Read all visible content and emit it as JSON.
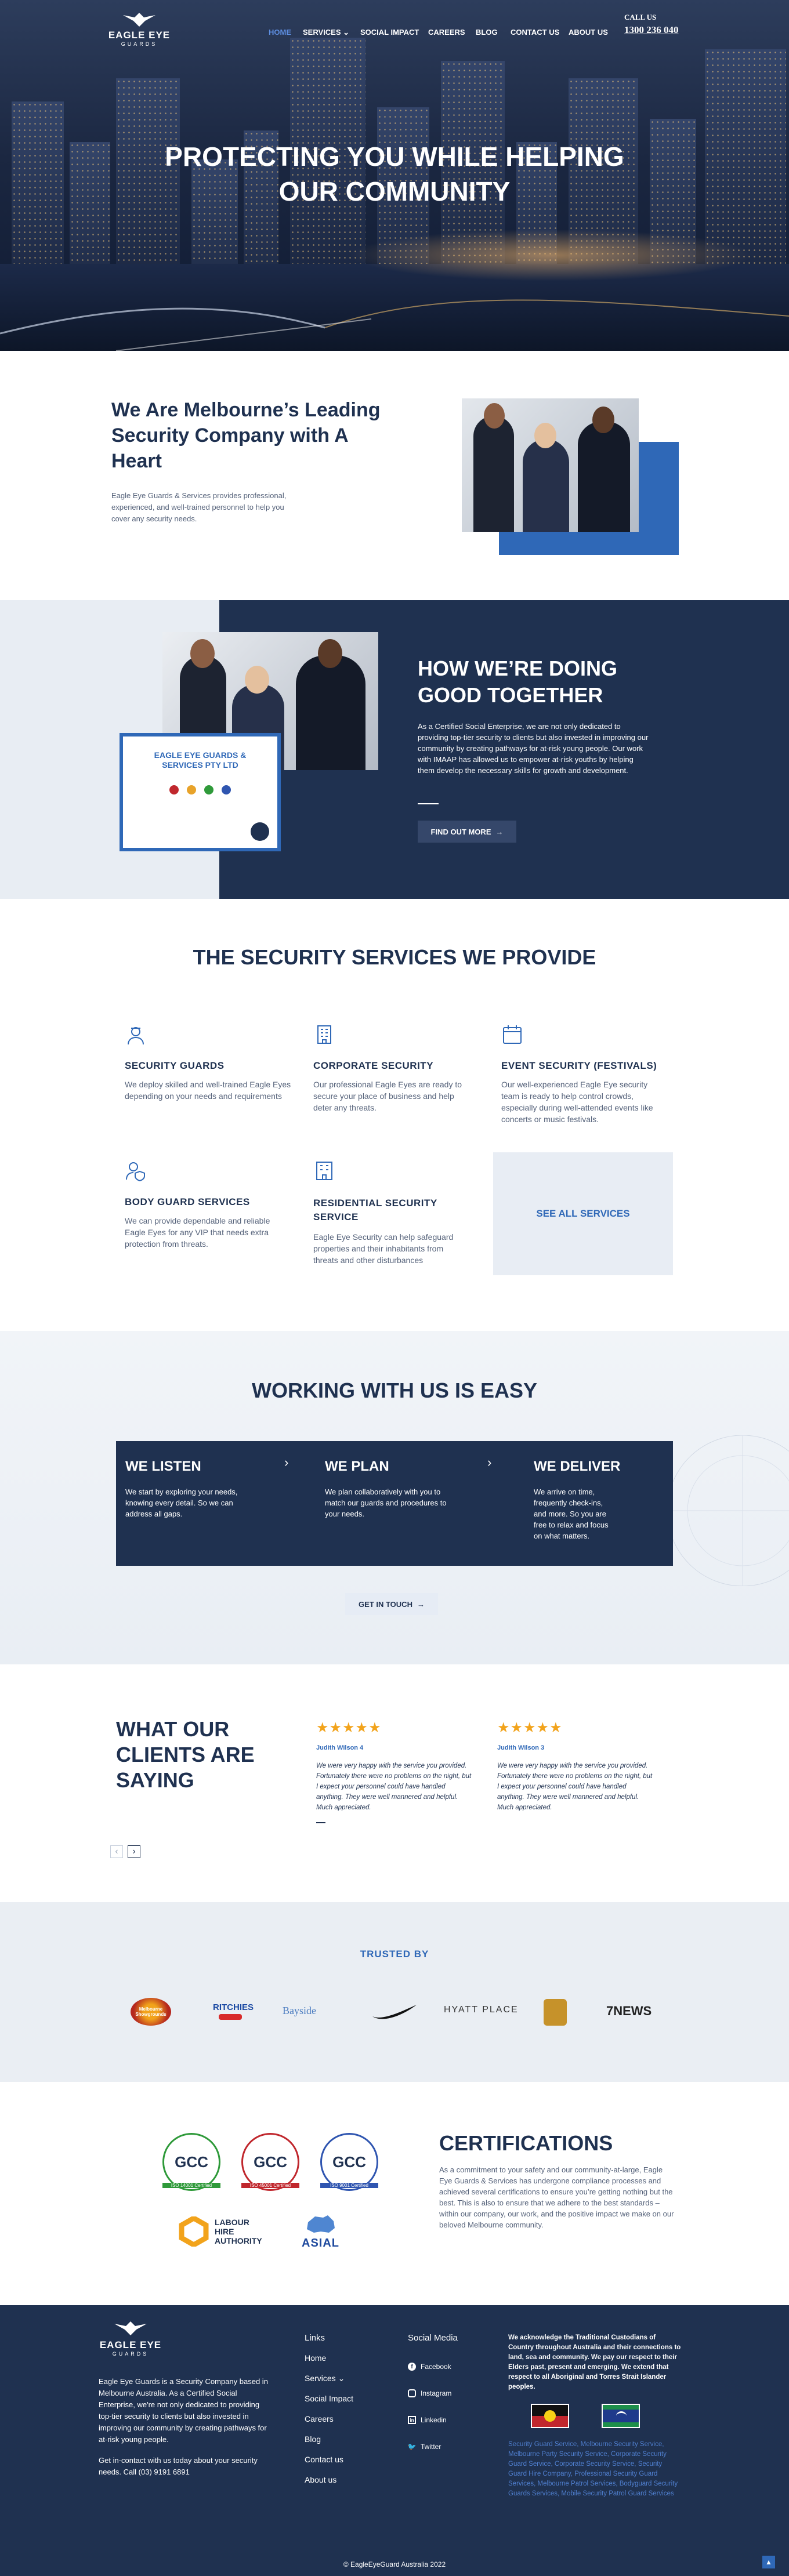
{
  "header": {
    "logo_line1": "EAGLE EYE",
    "logo_line2": "GUARDS",
    "nav": [
      "HOME",
      "SERVICES ⌄",
      "SOCIAL IMPACT",
      "CAREERS",
      "BLOG",
      "CONTACT US",
      "ABOUT US"
    ],
    "call_label": "CALL US",
    "phone": "1300 236 040"
  },
  "hero": {
    "title": "PROTECTING YOU WHILE HELPING OUR COMMUNITY"
  },
  "about": {
    "title": "We Are Melbourne’s Leading Security Company with A Heart",
    "body": "Eagle Eye Guards & Services provides professional, experienced, and well-trained personnel to help you cover any security needs."
  },
  "good": {
    "title": "HOW WE’RE DOING GOOD TOGETHER",
    "body": "As a Certified Social Enterprise, we are not only dedicated to providing top-tier security to clients but also invested in improving our community by creating pathways for at-risk young people. Our work with IMAAP has allowed us to empower at-risk youths by helping them develop the necessary skills for growth and development.",
    "button": "FIND OUT MORE",
    "cert_company": "EAGLE EYE GUARDS & SERVICES PTY LTD"
  },
  "services": {
    "title": "THE SECURITY SERVICES WE PROVIDE",
    "items": [
      {
        "icon": "guard-icon",
        "title": "SECURITY GUARDS",
        "body": "We deploy skilled and well-trained Eagle Eyes depending on your needs and requirements"
      },
      {
        "icon": "building-icon",
        "title": "CORPORATE SECURITY",
        "body": "Our professional Eagle Eyes are ready to secure your place of business and help deter any threats."
      },
      {
        "icon": "calendar-icon",
        "title": "EVENT SECURITY (FESTIVALS)",
        "body": "Our well-experienced Eagle Eye security team is ready to help control crowds, especially during well-attended events like concerts or music festivals."
      },
      {
        "icon": "bodyguard-icon",
        "title": "BODY GUARD SERVICES",
        "body": "We can provide dependable and reliable Eagle Eyes for any VIP that needs extra protection from threats."
      },
      {
        "icon": "residence-icon",
        "title": "RESIDENTIAL SECURITY SERVICE",
        "body": "Eagle Eye Security can help safeguard properties and their inhabitants from threats and other disturbances"
      }
    ],
    "see_all": "SEE ALL SERVICES"
  },
  "easy": {
    "title": "WORKING WITH US IS EASY",
    "steps": [
      {
        "title": "WE LISTEN",
        "body": "We start by exploring your needs, knowing every detail. So we can address all gaps."
      },
      {
        "title": "WE PLAN",
        "body": "We plan collaboratively with you to match our guards and procedures to your needs."
      },
      {
        "title": "WE DELIVER",
        "body": "We arrive on time, frequently check-ins, and more. So you are free to relax and focus on what matters."
      }
    ],
    "button": "GET IN TOUCH"
  },
  "testimonials": {
    "title": "WHAT OUR CLIENTS ARE SAYING",
    "stars": "★★★★★",
    "items": [
      {
        "name": "Judith Wilson 4",
        "body": "We were very happy with the service you provided. Fortunately there were no problems on the night, but I expect your personnel could have handled anything. They were well mannered and helpful. Much appreciated."
      },
      {
        "name": "Judith Wilson 3",
        "body": "We were very happy with the service you provided. Fortunately there were no problems on the night, but I expect your personnel could have handled anything. They were well mannered and helpful. Much appreciated."
      }
    ],
    "prev": "‹",
    "next": "›"
  },
  "trusted": {
    "title": "TRUSTED BY",
    "logos": [
      "Melbourne Showgrounds",
      "RITCHIES",
      "Bayside",
      "Nike",
      "HYATT PLACE",
      "Crest",
      "7NEWS"
    ]
  },
  "certifications": {
    "title": "CERTIFICATIONS",
    "body": "As a commitment to your safety and our community-at-large, Eagle Eye Guards & Services has undergone compliance processes and achieved several certifications to ensure you’re getting nothing but the best. This is also to ensure that we adhere to the best standards – within our company, our work, and the positive impact we make on our beloved Melbourne community.",
    "badges": [
      {
        "mark": "GCC",
        "caption": "ISO 14001 Certified",
        "color": "#2f9a3a"
      },
      {
        "mark": "GCC",
        "caption": "ISO 45001 Certified",
        "color": "#c0272d"
      },
      {
        "mark": "GCC",
        "caption": "ISO 9001 Certified",
        "color": "#2f55b0"
      }
    ],
    "labour": {
      "line1": "LABOUR",
      "line2": "HIRE",
      "line3": "AUTHORITY"
    },
    "asial": "ASIAL"
  },
  "footer": {
    "logo_line1": "EAGLE EYE",
    "logo_line2": "GUARDS",
    "about": "Eagle Eye Guards is a Security Company based in Melbourne Australia. As a Certified Social Enterprise, we're not only dedicated to providing top-tier security to clients but also invested in improving our community by creating pathways for at-risk young people.",
    "contact": "Get in-contact with us today about your security needs. Call (03) 9191 6891",
    "links_title": "Links",
    "links": [
      "Home",
      "Services ⌄",
      "Social Impact",
      "Careers",
      "Blog",
      "Contact us",
      "About us"
    ],
    "social_title": "Social Media",
    "social": [
      {
        "icon": "facebook-icon",
        "label": "Facebook"
      },
      {
        "icon": "instagram-icon",
        "label": "Instagram"
      },
      {
        "icon": "linkedin-icon",
        "label": "Linkedin"
      },
      {
        "icon": "twitter-icon",
        "label": "Twitter"
      }
    ],
    "acknowledgement": "We acknowledge the Traditional Custodians of Country throughout Australia and their connections to land, sea and community. We pay our respect to their Elders past, present and emerging. We extend that respect to all Aboriginal and Torres Strait Islander peoples.",
    "seo_links": "Security Guard Service, Melbourne Security Service, Melbourne Party Security Service, Corporate Security Guard Service, Corporate Security Service, Security Guard Hire Company, Professional Security Guard Services, Melbourne Patrol Services, Bodyguard Security Guards Services, Mobile Security Patrol Guard Services",
    "copyright": "© EagleEyeGuard Australia 2022"
  }
}
